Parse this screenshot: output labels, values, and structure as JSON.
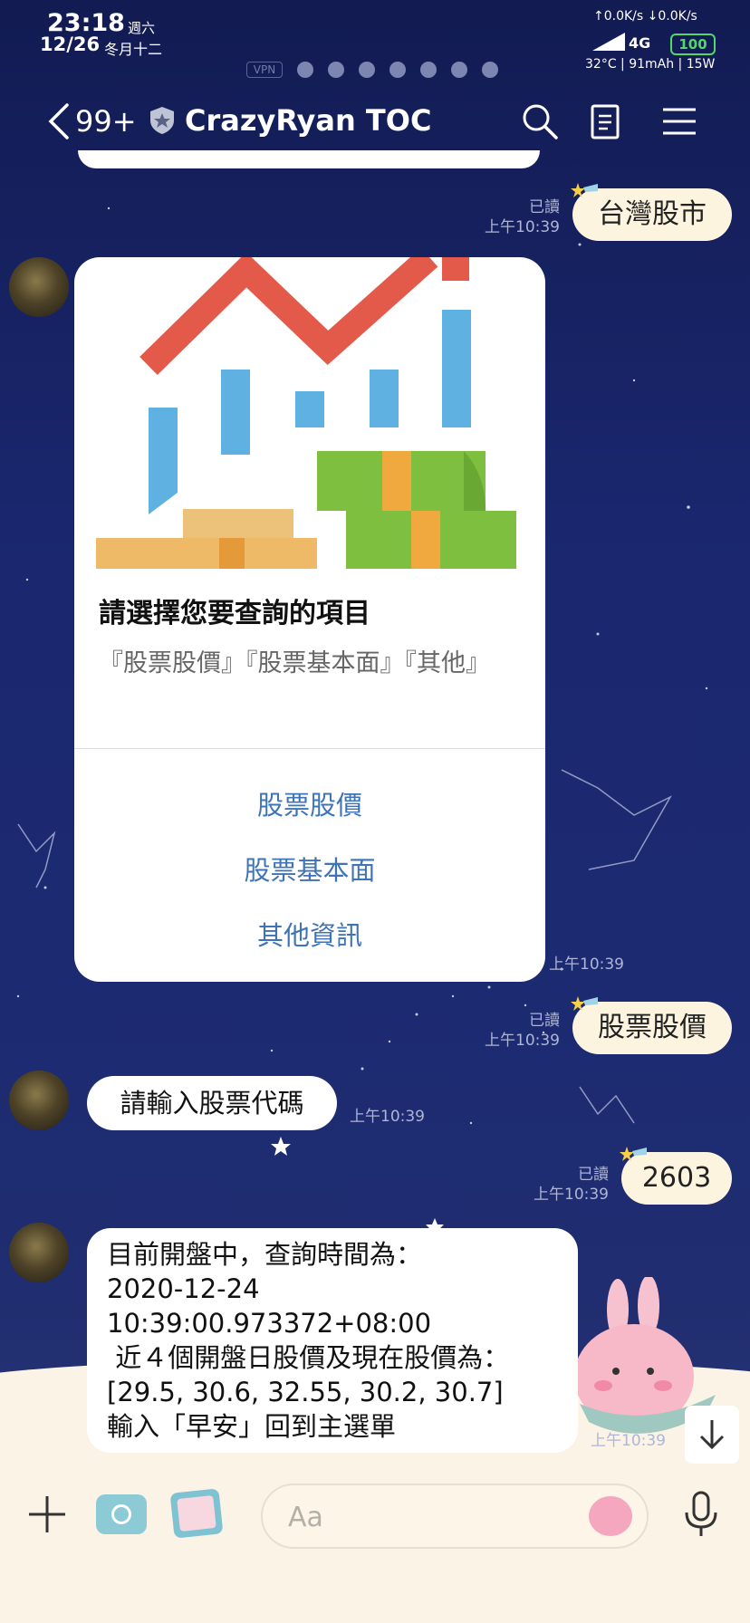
{
  "status_bar": {
    "time": "23:18",
    "weekday": "週六",
    "date": "12/26",
    "lunar_date": "冬月十二",
    "network_speed": "↑0.0K/s ↓0.0K/s",
    "network_type": "4G",
    "battery": "100",
    "device_info": "32°C | 91mAh | 15W",
    "vpn_label": "VPN"
  },
  "header": {
    "unread_count": "99+",
    "chat_title": "CrazyRyan TOC"
  },
  "messages": [
    {
      "sender": "me",
      "text": "台灣股市",
      "read": "已讀",
      "time": "上午10:39"
    },
    {
      "sender": "bot",
      "type": "card",
      "card_title": "請選擇您要查詢的項目",
      "card_desc": "『股票股價』『股票基本面』『其他』",
      "actions": [
        "股票股價",
        "股票基本面",
        "其他資訊"
      ],
      "time": "上午10:39"
    },
    {
      "sender": "me",
      "text": "股票股價",
      "read": "已讀",
      "time": "上午10:39"
    },
    {
      "sender": "bot",
      "text": "請輸入股票代碼",
      "time": "上午10:39"
    },
    {
      "sender": "me",
      "text": "2603",
      "read": "已讀",
      "time": "上午10:39"
    },
    {
      "sender": "bot",
      "lines": [
        "目前開盤中，查詢時間為：",
        "2020-12-24",
        "10:39:00.973372+08:00",
        " 近４個開盤日股價及現在股價為：",
        "[29.5, 30.6, 32.55, 30.2, 30.7]",
        "輸入「早安」回到主選單"
      ],
      "time": "上午10:39"
    }
  ],
  "input_bar": {
    "placeholder": "Aa"
  },
  "colors": {
    "my_bubble": "#fdf4df",
    "card_action": "#3f73b8",
    "background": "#1b2870"
  }
}
